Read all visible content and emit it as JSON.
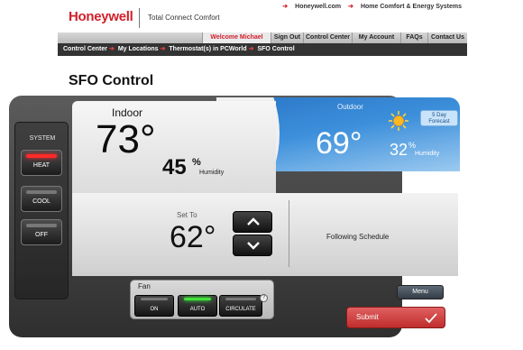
{
  "header": {
    "logo": "Honeywell",
    "tagline": "Total Connect Comfort",
    "top_links": [
      {
        "label": "Honeywell.com"
      },
      {
        "label": "Home Comfort & Energy Systems"
      }
    ]
  },
  "nav": {
    "welcome": "Welcome Michael",
    "sign_out": "Sign Out",
    "control_center": "Control Center",
    "my_account": "My Account",
    "faqs": "FAQs",
    "contact_us": "Contact Us"
  },
  "breadcrumb": [
    "Control Center",
    "My Locations",
    "Thermostat(s) in PCWorld",
    "SFO Control"
  ],
  "page_title": "SFO Control",
  "system": {
    "label": "SYSTEM",
    "modes": [
      {
        "label": "HEAT",
        "active": true
      },
      {
        "label": "COOL",
        "active": false
      },
      {
        "label": "OFF",
        "active": false
      }
    ]
  },
  "indoor": {
    "label": "Indoor",
    "temperature": "73°",
    "humidity_value": "45",
    "humidity_unit": "%",
    "humidity_label": "Humidity"
  },
  "outdoor": {
    "label": "Outdoor",
    "temperature": "69°",
    "humidity_value": "32",
    "humidity_unit": "%",
    "humidity_label": "Humidity",
    "forecast_line1": "5 Day",
    "forecast_line2": "Forecast",
    "weather_icon": "sun-icon"
  },
  "setpoint": {
    "label": "Set To",
    "value": "62°",
    "schedule_status": "Following Schedule"
  },
  "fan": {
    "label": "Fan",
    "modes": [
      {
        "label": "ON",
        "active": false
      },
      {
        "label": "AUTO",
        "active": true
      },
      {
        "label": "CIRCULATE",
        "active": false
      }
    ],
    "help": "?"
  },
  "actions": {
    "menu": "Menu",
    "submit": "Submit"
  },
  "colors": {
    "brand_red": "#d21f2b",
    "heat_indicator": "#ff2a2a",
    "fan_indicator": "#3fe23a",
    "sky_blue": "#3c8fdb"
  }
}
